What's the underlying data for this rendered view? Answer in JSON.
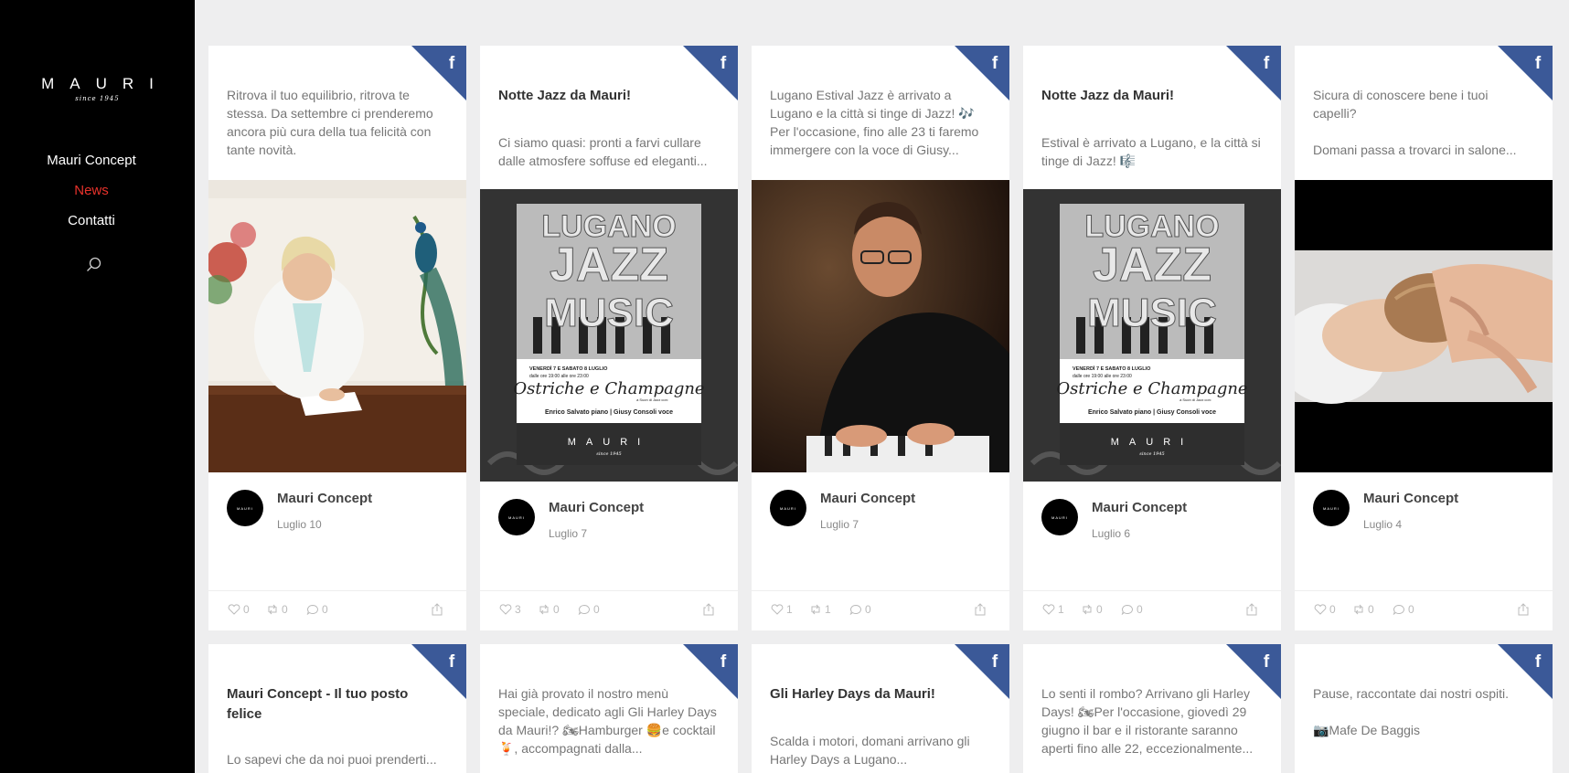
{
  "sidebar": {
    "logo_word": "MAURI",
    "logo_tagline": "since 1945",
    "nav": [
      {
        "label": "Mauri Concept"
      },
      {
        "label": "News"
      },
      {
        "label": "Contatti"
      }
    ],
    "active_color": "#e8322b"
  },
  "source_icon": "facebook-icon",
  "brand_colors": {
    "facebook": "#3b5998"
  },
  "cards": [
    {
      "title": "",
      "text": "Ritrova il tuo equilibrio, ritrova te stessa. Da settembre ci prenderemo ancora più cura della tua felicità con tante novità.",
      "author": "Mauri Concept",
      "date": "Luglio 10",
      "likes": "0",
      "shares": "0",
      "comments": "0"
    },
    {
      "title": "Notte Jazz da Mauri!",
      "text": "Ci siamo quasi: pronti a farvi cullare dalle atmosfere soffuse ed eleganti...",
      "poster": {
        "headline": [
          "LUGANO",
          "JAZZ",
          "MUSIC"
        ],
        "dates": "VENERDÌ 7 E SABATO 8 LUGLIO",
        "times": "dalle ore 19:00 alle ore 23:00",
        "event": "Ostriche e Champagne",
        "subtitle": "a Suon di Jazz con:",
        "performers": "Enrico Salvato piano | Giusy Consoli voce",
        "brand": "MAURI",
        "brand_tag": "since 1945"
      },
      "author": "Mauri Concept",
      "date": "Luglio 7",
      "likes": "3",
      "shares": "0",
      "comments": "0"
    },
    {
      "title": "",
      "text": "Lugano Estival Jazz è arrivato a Lugano e la città si tinge di Jazz! 🎶 Per l'occasione, fino alle 23 ti faremo immergere con la voce di Giusy...",
      "author": "Mauri Concept",
      "date": "Luglio 7",
      "likes": "1",
      "shares": "1",
      "comments": "0"
    },
    {
      "title": "Notte Jazz da Mauri!",
      "text": "Estival è arrivato a Lugano, e la città si tinge di Jazz! 🎼",
      "poster": {
        "headline": [
          "LUGANO",
          "JAZZ",
          "MUSIC"
        ],
        "dates": "VENERDÌ 7 E SABATO 8 LUGLIO",
        "times": "dalle ore 19:00 alle ore 23:00",
        "event": "Ostriche e Champagne",
        "subtitle": "a Suon di Jazz con:",
        "performers": "Enrico Salvato piano | Giusy Consoli voce",
        "brand": "MAURI",
        "brand_tag": "since 1945"
      },
      "author": "Mauri Concept",
      "date": "Luglio 6",
      "likes": "1",
      "shares": "0",
      "comments": "0"
    },
    {
      "title": "",
      "text": "Sicura di conoscere bene i tuoi capelli?\n\nDomani passa a trovarci in salone...",
      "author": "Mauri Concept",
      "date": "Luglio 4",
      "likes": "0",
      "shares": "0",
      "comments": "0"
    },
    {
      "title": "Mauri Concept - Il tuo posto felice",
      "text": "Lo sapevi che da noi puoi prenderti..."
    },
    {
      "title": "",
      "text": "Hai già provato il nostro menù speciale, dedicato agli Gli Harley Days da Mauri!? 🏍Hamburger 🍔e cocktail 🍹, accompagnati dalla..."
    },
    {
      "title": "Gli Harley Days da Mauri!",
      "text": "Scalda i motori, domani arrivano gli Harley Days a Lugano..."
    },
    {
      "title": "",
      "text": "Lo senti il rombo? Arrivano gli Harley Days! 🏍Per l'occasione, giovedì 29 giugno il bar e il ristorante saranno aperti fino alle 22, eccezionalmente..."
    },
    {
      "title": "",
      "text": "Pause, raccontate dai nostri ospiti.\n\n📷Mafe De Baggis"
    }
  ]
}
